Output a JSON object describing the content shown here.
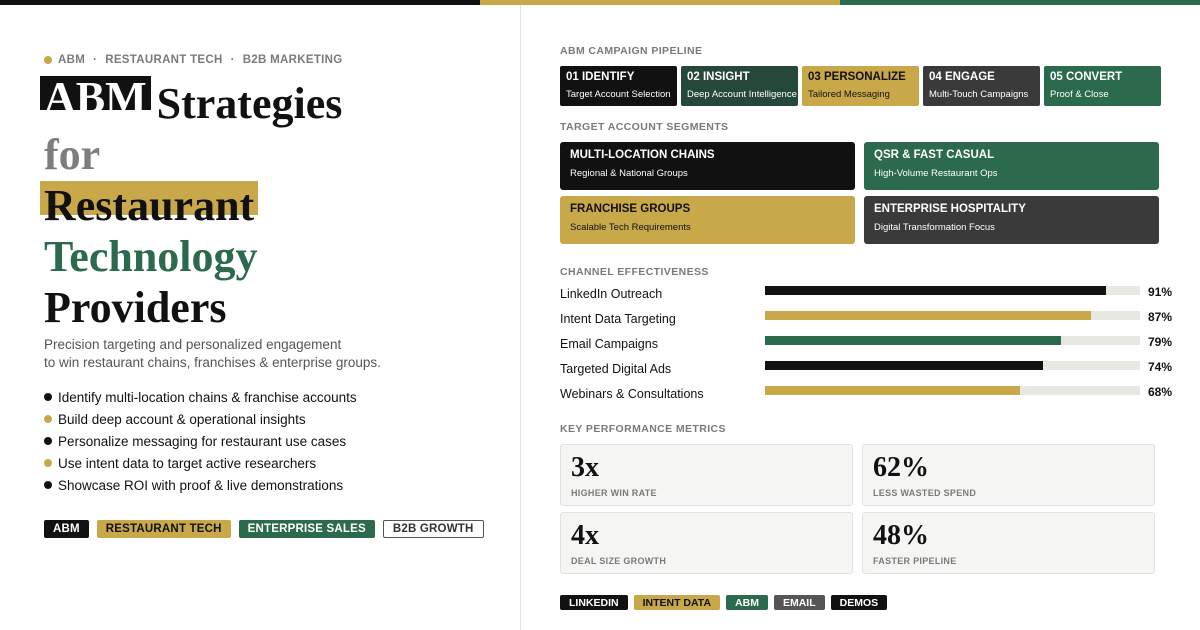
{
  "colors": {
    "black": "#111111",
    "gold": "#c9a84a",
    "green": "#2b6a4d",
    "charcoal": "#3a3a3a",
    "grey": "#555555"
  },
  "eyebrow": [
    "ABM",
    "RESTAURANT TECH",
    "B2B MARKETING"
  ],
  "eyebrow_sep": "·",
  "title": {
    "abm": "ABM",
    "strategies": "Strategies",
    "for": "for",
    "restaurant": "Restaurant",
    "technology": "Technology",
    "providers": "Providers"
  },
  "subtitle": [
    "Precision targeting and personalized engagement",
    "to win restaurant chains, franchises & enterprise groups."
  ],
  "bullets": [
    {
      "text": "Identify multi-location chains & franchise accounts",
      "color": "#111111"
    },
    {
      "text": "Build deep account & operational insights",
      "color": "#c9a84a"
    },
    {
      "text": "Personalize messaging for restaurant use cases",
      "color": "#111111"
    },
    {
      "text": "Use intent data to target active researchers",
      "color": "#c9a84a"
    },
    {
      "text": "Showcase ROI with proof & live demonstrations",
      "color": "#111111"
    }
  ],
  "tags_left": [
    "ABM",
    "RESTAURANT TECH",
    "ENTERPRISE SALES",
    "B2B GROWTH"
  ],
  "sections": {
    "pipeline": "ABM CAMPAIGN PIPELINE",
    "segments": "TARGET ACCOUNT SEGMENTS",
    "channels": "CHANNEL EFFECTIVENESS",
    "metrics": "KEY PERFORMANCE METRICS"
  },
  "pipeline": [
    {
      "title": "01 IDENTIFY",
      "sub": "Target Account Selection"
    },
    {
      "title": "02 INSIGHT",
      "sub": "Deep Account Intelligence"
    },
    {
      "title": "03 PERSONALIZE",
      "sub": "Tailored Messaging"
    },
    {
      "title": "04 ENGAGE",
      "sub": "Multi-Touch Campaigns"
    },
    {
      "title": "05 CONVERT",
      "sub": "Proof & Close"
    }
  ],
  "segments": [
    {
      "title": "MULTI-LOCATION CHAINS",
      "sub": "Regional & National Groups"
    },
    {
      "title": "QSR & FAST CASUAL",
      "sub": "High-Volume Restaurant Ops"
    },
    {
      "title": "FRANCHISE GROUPS",
      "sub": "Scalable Tech Requirements"
    },
    {
      "title": "ENTERPRISE HOSPITALITY",
      "sub": "Digital Transformation Focus"
    }
  ],
  "channels": [
    {
      "name": "LinkedIn Outreach",
      "pct": 91,
      "label": "91%",
      "color": "#111111"
    },
    {
      "name": "Intent Data Targeting",
      "pct": 87,
      "label": "87%",
      "color": "#c9a84a"
    },
    {
      "name": "Email Campaigns",
      "pct": 79,
      "label": "79%",
      "color": "#2b6a4d"
    },
    {
      "name": "Targeted Digital Ads",
      "pct": 74,
      "label": "74%",
      "color": "#111111"
    },
    {
      "name": "Webinars & Consultations",
      "pct": 68,
      "label": "68%",
      "color": "#c9a84a"
    }
  ],
  "metrics": [
    {
      "value": "3x",
      "label": "HIGHER WIN RATE"
    },
    {
      "value": "62%",
      "label": "LESS WASTED SPEND"
    },
    {
      "value": "4x",
      "label": "DEAL SIZE GROWTH"
    },
    {
      "value": "48%",
      "label": "FASTER PIPELINE"
    }
  ],
  "tags_right": [
    "LINKEDIN",
    "INTENT DATA",
    "ABM",
    "EMAIL",
    "DEMOS"
  ]
}
